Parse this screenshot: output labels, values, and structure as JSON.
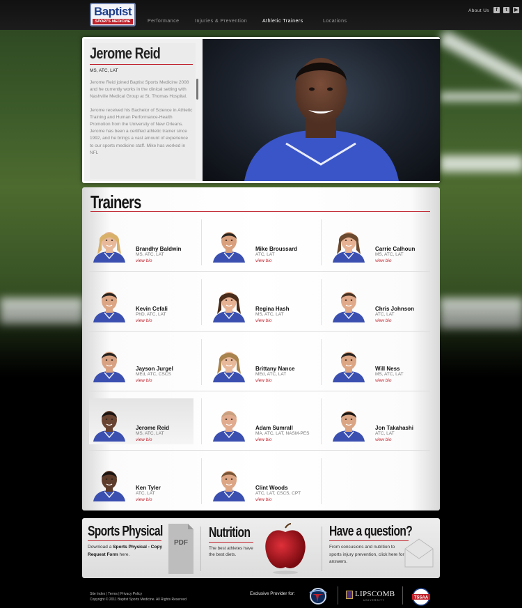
{
  "header": {
    "logo": {
      "word": "Baptist",
      "sub": "SPORTS MEDICINE"
    },
    "nav": [
      "Performance",
      "Injuries & Prevention",
      "Athletic Trainers",
      "Locations"
    ],
    "active_nav": "Athletic Trainers",
    "about_label": "About Us",
    "social_icons": [
      "facebook-icon",
      "twitter-icon",
      "youtube-icon"
    ]
  },
  "profile": {
    "name": "Jerome Reid",
    "credentials": "MS, ATC, LAT",
    "bio": [
      "Jerome Reid joined Baptist Sports Medicine 2008 and he currently works in the clinical setting with Nashville Medical Group at St. Thomas Hospital.",
      "Jerome received his Bachelor of Science in Athletic Training and Human Performance-Health Promotion from the University of New Orleans. Jerome has been a certified athletic trainer since 1992, and he brings a vast amount of experience to our sports medicine staff. Mike has worked in NFL"
    ]
  },
  "trainers": {
    "title": "Trainers",
    "view_bio_label": "view bio",
    "items": [
      {
        "name": "Brandhy Baldwin",
        "credentials": "MS, ATC, LAT",
        "skin": "#e8b89a",
        "hair": "#d9b06a",
        "shirt": "#3a4fb0"
      },
      {
        "name": "Mike Broussard",
        "credentials": "ATC, LAT",
        "skin": "#d9a07e",
        "hair": "#2c2620",
        "shirt": "#3a4fb0"
      },
      {
        "name": "Carrie Calhoun",
        "credentials": "MS, ATC, LAT",
        "skin": "#e6b293",
        "hair": "#6b4a30",
        "shirt": "#3a4fb0"
      },
      {
        "name": "Kevin Cefali",
        "credentials": "PhD, ATC, LAT",
        "skin": "#dca584",
        "hair": "#2a2420",
        "shirt": "#3a4fb0"
      },
      {
        "name": "Regina Hash",
        "credentials": "MS, ATC, LAT",
        "skin": "#e6b293",
        "hair": "#4a2c1a",
        "shirt": "#3a4fb0"
      },
      {
        "name": "Chris Johnson",
        "credentials": "ATC, LAT",
        "skin": "#e0a98a",
        "hair": "#4a3424",
        "shirt": "#3a4fb0"
      },
      {
        "name": "Jayson Jurgel",
        "credentials": "MEd, ATC, CSCS",
        "skin": "#d8a282",
        "hair": "#2a2420",
        "shirt": "#3a4fb0"
      },
      {
        "name": "Brittany Nance",
        "credentials": "MEd, ATC, LAT",
        "skin": "#e8b89a",
        "hair": "#a8834e",
        "shirt": "#3a4fb0"
      },
      {
        "name": "Will Ness",
        "credentials": "MS, ATC, LAT",
        "skin": "#dca584",
        "hair": "#2a2420",
        "shirt": "#3a4fb0"
      },
      {
        "name": "Jerome Reid",
        "credentials": "MS, ATC, LAT",
        "skin": "#6a4432",
        "hair": "#1a1412",
        "shirt": "#3a4fb0"
      },
      {
        "name": "Adam Sumrall",
        "credentials": "MA, ATC, LAT, NASM-PES",
        "skin": "#e0ab8e",
        "hair": "#c8a080",
        "shirt": "#3a4fb0"
      },
      {
        "name": "Jon Takahashi",
        "credentials": "ATC, LAT",
        "skin": "#d9a585",
        "hair": "#1a1614",
        "shirt": "#3a4fb0"
      },
      {
        "name": "Ken Tyler",
        "credentials": "ATC, LAT",
        "skin": "#5e3c2c",
        "hair": "#1a1412",
        "shirt": "#3a4fb0"
      },
      {
        "name": "Clint Woods",
        "credentials": "ATC, LAT, CSCS, CPT",
        "skin": "#dca584",
        "hair": "#7a5636",
        "shirt": "#3a4fb0"
      }
    ],
    "selected_index": 9
  },
  "promos": {
    "sports_physical": {
      "title": "Sports Physical",
      "text_pre": "Download a ",
      "text_bold": "Sports Physical - Copy Request Form",
      "text_post": " here.",
      "pdf_label": "PDF"
    },
    "nutrition": {
      "title": "Nutrition",
      "text": "The best athletes have the best diets."
    },
    "question": {
      "title": "Have a question?",
      "text": "From concusions and nutrition to sports injury prevention, click here for answers."
    }
  },
  "footer": {
    "links": [
      "Site Index",
      "Terms",
      "Privacy Policy"
    ],
    "copyright": "Copyright © 2011 Baptist Sports Medicine. All Rights Reserved",
    "exclusive": "Exclusive Provider for:",
    "partners": {
      "lipscomb": "LIPSCOMB",
      "lipscomb_sub": "UNIVERSITY",
      "tssaa": "TSSAA"
    }
  },
  "colors": {
    "accent": "#c0202a",
    "brand_blue": "#1d3f8c",
    "shirt_blue": "#3a4fb0"
  }
}
